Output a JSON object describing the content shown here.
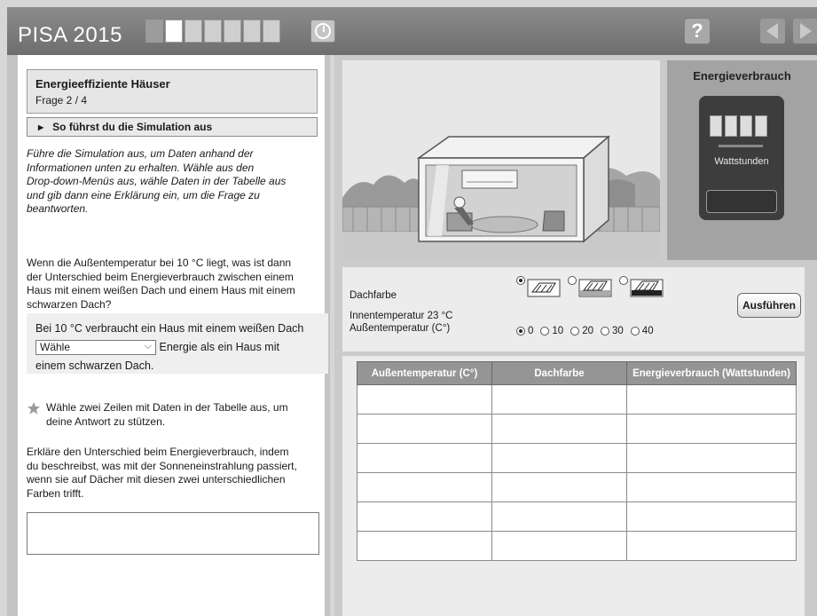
{
  "header": {
    "title": "PISA 2015",
    "progress_total": 7,
    "progress_current": 2,
    "help_label": "?"
  },
  "left": {
    "question_title": "Energieeffiziente Häuser",
    "question_number": "Frage 2 / 4",
    "sim_toggle_label": "So führst du die Simulation aus",
    "instructions": [
      "Führe die Simulation aus, um Daten anhand der",
      "Informationen unten zu erhalten. Wähle aus den",
      "Drop-down-Menüs aus, wähle Daten in der Tabelle aus",
      "und gib dann eine Erklärung ein, um die Frage zu",
      "beantworten."
    ],
    "question": [
      "Wenn die Außentemperatur bei 10 °C liegt, was ist dann",
      "der Unterschied beim Energieverbrauch zwischen einem",
      "Haus mit einem weißen Dach und einem Haus mit einem",
      "schwarzen Dach?"
    ],
    "answer_line1": "Bei 10 °C verbraucht ein Haus mit einem weißen Dach",
    "select_value": "Wähle",
    "answer_after_select": "Energie als ein Haus mit",
    "answer_line3": "einem schwarzen Dach.",
    "select_rows_hint": [
      "Wähle zwei Zeilen mit Daten in der Tabelle aus, um",
      "deine Antwort zu stützen."
    ],
    "explain_prompt": [
      "Erkläre den Unterschied beim Energieverbrauch, indem",
      "du beschreibst, was mit der Sonneneinstrahlung passiert,",
      "wenn sie auf Dächer mit diesen zwei unterschiedlichen",
      "Farben trifft."
    ],
    "explanation_value": ""
  },
  "meter": {
    "title": "Energieverbrauch",
    "unit_label": "Wattstunden"
  },
  "controls": {
    "roof_label": "Dachfarbe",
    "roof_options_selected": 0,
    "indoor_temp": "Innentemperatur 23 °C",
    "outdoor_label": "Außentemperatur (C°)",
    "temp_options": [
      "0",
      "10",
      "20",
      "30",
      "40"
    ],
    "temp_selected": 0,
    "run_label": "Ausführen"
  },
  "table": {
    "headers": [
      "Außentemperatur (C°)",
      "Dachfarbe",
      "Energieverbrauch (Wattstunden)"
    ],
    "row_count": 6
  },
  "colors": {
    "header_bg": "#7d7d7d",
    "panel_bg": "#cbcbcb",
    "table_header": "#959595"
  }
}
